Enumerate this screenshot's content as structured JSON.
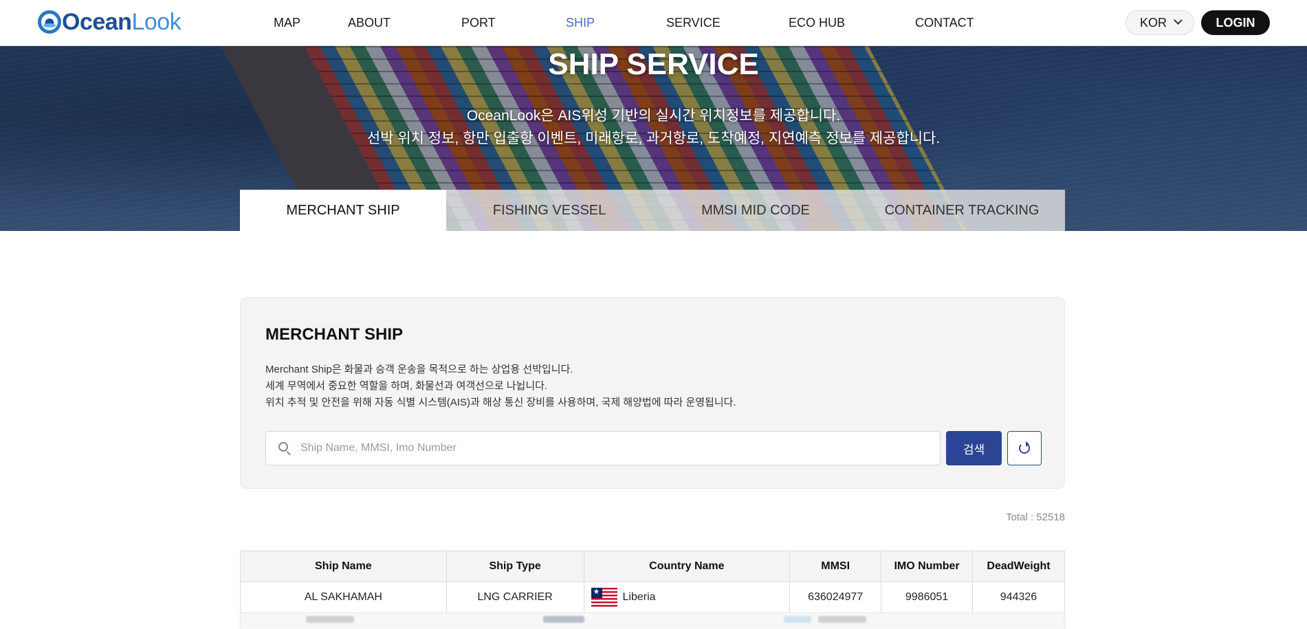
{
  "header": {
    "logo": {
      "part1": "Ocean",
      "part2": "Look"
    },
    "nav": [
      "MAP",
      "ABOUT",
      "PORT",
      "SHIP",
      "SERVICE",
      "ECO HUB",
      "CONTACT"
    ],
    "nav_active": "SHIP",
    "lang": "KOR",
    "login": "LOGIN"
  },
  "hero": {
    "title": "SHIP SERVICE",
    "line1": "OceanLook은 AIS위성 기반의 실시간 위치정보를 제공합니다.",
    "line2": "선박 위치 정보, 항만 입출항 이벤트, 미래항로, 과거항로, 도착예정, 지연예측 정보를 제공합니다."
  },
  "tabs": [
    "MERCHANT SHIP",
    "FISHING VESSEL",
    "MMSI MID CODE",
    "CONTAINER TRACKING"
  ],
  "tab_active": "MERCHANT SHIP",
  "card": {
    "title": "MERCHANT SHIP",
    "desc1": "Merchant Ship은 화물과 승객 운송을 목적으로 하는 상업용 선박입니다.",
    "desc2": "세계 무역에서 중요한 역할을 하며, 화물선과 여객선으로 나뉩니다.",
    "desc3": "위치 추적 및 안전을 위해 자동 식별 시스템(AIS)과 해상 통신 장비를 사용하며, 국제 해양법에 따라 운영됩니다.",
    "search_placeholder": "Ship Name, MMSI, Imo Number",
    "search_button": "검색"
  },
  "total": "Total : 52518",
  "table": {
    "headers": [
      "Ship Name",
      "Ship Type",
      "Country Name",
      "MMSI",
      "IMO Number",
      "DeadWeight"
    ],
    "rows": [
      {
        "ship_name": "AL SAKHAMAH",
        "ship_type": "LNG CARRIER",
        "country": "Liberia",
        "mmsi": "636024977",
        "imo": "9986051",
        "deadweight": "944326"
      }
    ]
  },
  "colors": {
    "accent": "#2b4596",
    "nav_active": "#4a6cc2",
    "login_bg": "#111111"
  }
}
